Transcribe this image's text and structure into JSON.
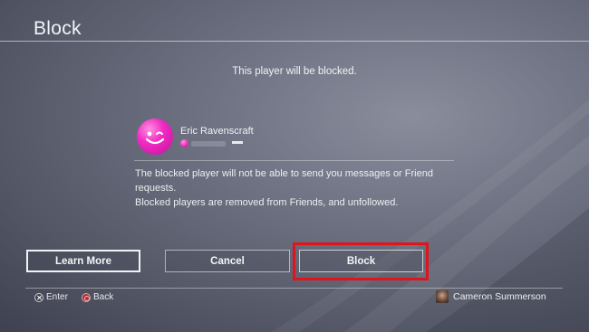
{
  "header": {
    "title": "Block"
  },
  "dialog": {
    "message": "This player will be blocked.",
    "player": {
      "name": "Eric Ravenscraft"
    },
    "info_lines": [
      "The blocked player will not be able to send you messages or Friend requests.",
      "Blocked players are removed from Friends, and unfollowed."
    ]
  },
  "buttons": {
    "learn_more": "Learn More",
    "cancel": "Cancel",
    "block": "Block"
  },
  "footer": {
    "enter_label": "Enter",
    "back_label": "Back",
    "user_name": "Cameron Summerson"
  },
  "colors": {
    "highlight": "#e0141c",
    "avatar": "#f02bc4"
  },
  "icons": [
    "cross-button-icon",
    "circle-button-icon",
    "smiley-avatar-icon",
    "user-avatar-icon"
  ]
}
